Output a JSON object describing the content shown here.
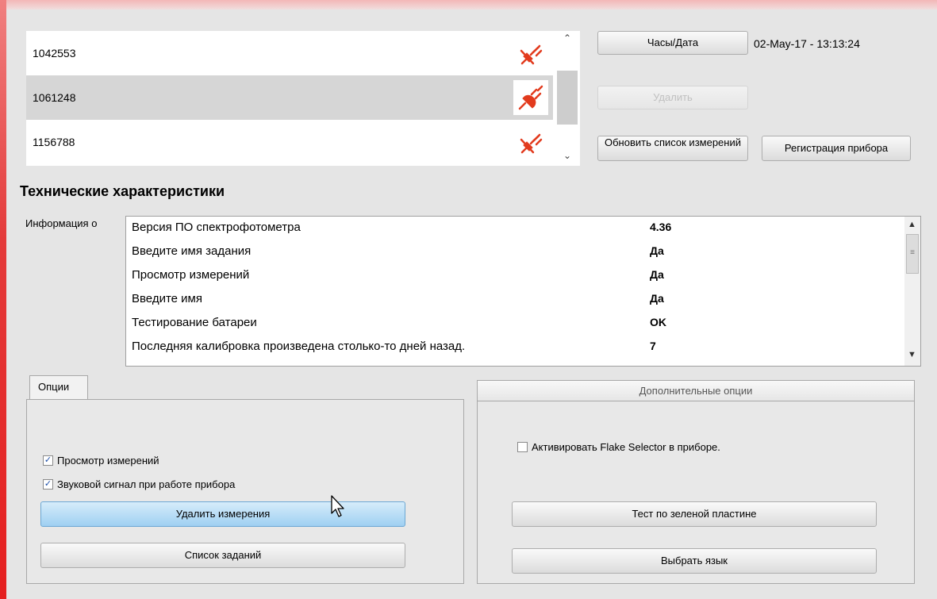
{
  "devices": [
    {
      "serial": "1042553",
      "status": "disconnected",
      "selected": false
    },
    {
      "serial": "1061248",
      "status": "connected",
      "selected": true
    },
    {
      "serial": "1156788",
      "status": "disconnected",
      "selected": false
    }
  ],
  "buttons": {
    "clock_date": "Часы/Дата",
    "delete": "Удалить",
    "refresh_measurements": "Обновить список измерений",
    "register_device": "Регистрация прибора",
    "delete_measurements": "Удалить измерения",
    "task_list": "Список заданий",
    "green_plate_test": "Тест по зеленой пластине",
    "select_language": "Выбрать язык"
  },
  "clock_value": "02-May-17 - 13:13:24",
  "tech_specs": {
    "title": "Технические характеристики",
    "info_label": "Информация о",
    "rows": [
      {
        "key": "Версия ПО спектрофотометра",
        "value": "4.36"
      },
      {
        "key": "Введите имя задания",
        "value": "Да"
      },
      {
        "key": "Просмотр измерений",
        "value": "Да"
      },
      {
        "key": "Введите имя",
        "value": "Да"
      },
      {
        "key": "Тестирование батареи",
        "value": "OK"
      },
      {
        "key": "Последняя калибровка произведена столько-то дней назад.",
        "value": "7"
      }
    ]
  },
  "options": {
    "tab_label": "Опции",
    "checkboxes": [
      {
        "label": "Просмотр измерений",
        "checked": true
      },
      {
        "label": "Звуковой сигнал при работе прибора",
        "checked": true
      }
    ]
  },
  "extra_options": {
    "header": "Дополнительные опции",
    "checkbox": {
      "label": "Активировать Flake Selector в приборе.",
      "checked": false
    }
  },
  "icons": {
    "plug_connected": "plug-connected-icon",
    "plug_disconnected": "plug-disconnected-icon",
    "accent_red": "#e23b1e"
  }
}
